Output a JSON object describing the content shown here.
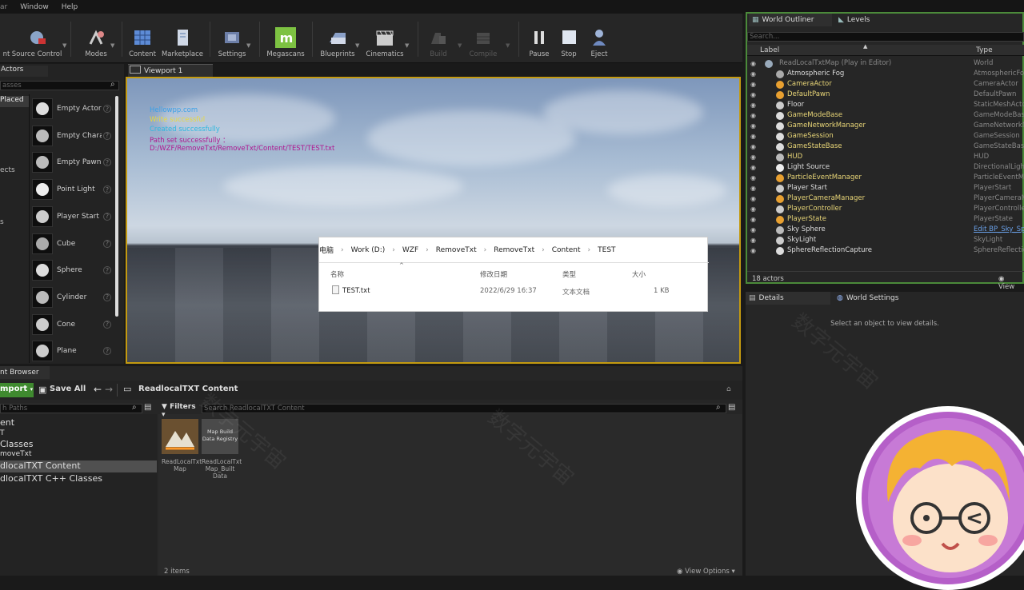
{
  "menu": [
    "Window",
    "Help"
  ],
  "toolbar": {
    "source_control": "Source Control",
    "modes": "Modes",
    "content": "Content",
    "marketplace": "Marketplace",
    "settings": "Settings",
    "megascans": "Megascans",
    "blueprints": "Blueprints",
    "cinematics": "Cinematics",
    "build": "Build",
    "compile": "Compile",
    "pause": "Pause",
    "stop": "Stop",
    "eject": "Eject"
  },
  "place": {
    "tab": "Actors",
    "search_placeholder": "asses",
    "recently_placed": "Placed",
    "categories": [
      "ects",
      "s"
    ],
    "items": [
      "Empty Actor",
      "Empty Chara",
      "Empty Pawn",
      "Point Light",
      "Player Start",
      "Cube",
      "Sphere",
      "Cylinder",
      "Cone",
      "Plane"
    ]
  },
  "viewport": {
    "tab": "Viewport 1",
    "debug": [
      "Hellowpp.com",
      "Write successful",
      "Created successfully",
      "Path set successfully ：",
      "D:/WZF/RemoveTxt/RemoveTxt/Content/TEST/TEST.txt"
    ]
  },
  "explorer": {
    "crumbs": [
      "电脑",
      "Work (D:)",
      "WZF",
      "RemoveTxt",
      "RemoveTxt",
      "Content",
      "TEST"
    ],
    "headers": {
      "name": "名称",
      "date": "修改日期",
      "type": "类型",
      "size": "大小"
    },
    "file": {
      "name": "TEST.txt",
      "date": "2022/6/29 16:37",
      "type": "文本文档",
      "size": "1 KB"
    }
  },
  "outliner": {
    "tab": "World Outliner",
    "tab2": "Levels",
    "search": "Search...",
    "col_label": "Label",
    "col_type": "Type",
    "rows": [
      {
        "name": "ReadLocalTxtMap (Play in Editor)",
        "type": "World",
        "style": "dim"
      },
      {
        "name": "Atmospheric Fog",
        "type": "AtmosphericFog",
        "style": ""
      },
      {
        "name": "CameraActor",
        "type": "CameraActor",
        "style": "ylw"
      },
      {
        "name": "DefaultPawn",
        "type": "DefaultPawn",
        "style": "ylw"
      },
      {
        "name": "Floor",
        "type": "StaticMeshActor",
        "style": ""
      },
      {
        "name": "GameModeBase",
        "type": "GameModeBase",
        "style": "ylw"
      },
      {
        "name": "GameNetworkManager",
        "type": "GameNetworkManager",
        "style": "ylw"
      },
      {
        "name": "GameSession",
        "type": "GameSession",
        "style": "ylw"
      },
      {
        "name": "GameStateBase",
        "type": "GameStateBase",
        "style": "ylw"
      },
      {
        "name": "HUD",
        "type": "HUD",
        "style": "ylw"
      },
      {
        "name": "Light Source",
        "type": "DirectionalLight",
        "style": ""
      },
      {
        "name": "ParticleEventManager",
        "type": "ParticleEventManager",
        "style": "ylw"
      },
      {
        "name": "Player Start",
        "type": "PlayerStart",
        "style": ""
      },
      {
        "name": "PlayerCameraManager",
        "type": "PlayerCameraManager",
        "style": "ylw"
      },
      {
        "name": "PlayerController",
        "type": "PlayerController",
        "style": "ylw"
      },
      {
        "name": "PlayerState",
        "type": "PlayerState",
        "style": "ylw"
      },
      {
        "name": "Sky Sphere",
        "type": "Edit BP_Sky_Sphere",
        "style": ""
      },
      {
        "name": "SkyLight",
        "type": "SkyLight",
        "style": ""
      },
      {
        "name": "SphereReflectionCapture",
        "type": "SphereReflectionCapture",
        "style": ""
      }
    ],
    "count": "18 actors",
    "view": "View"
  },
  "details": {
    "tab": "Details",
    "tab2": "World Settings",
    "empty": "Select an object to view details."
  },
  "content_browser": {
    "tab": "nt Browser",
    "import": "mport",
    "save_all": "Save All",
    "path": "ReadlocalTXT Content",
    "search_paths": "h Paths",
    "filters": "Filters",
    "search_assets": "Search ReadlocalTXT Content",
    "tree": [
      "ent",
      "T",
      "Classes",
      "moveTxt",
      "dlocalTXT Content",
      "dlocalTXT C++ Classes"
    ],
    "assets": [
      {
        "name": "ReadLocalTxt Map"
      },
      {
        "name": "ReadLocalTxt Map_Built Data",
        "thumb": "Map Build Data Registry"
      }
    ],
    "count": "2 items",
    "view_options": "View Options"
  },
  "colors": {
    "accent": "#c49a10",
    "selection": "#4b8a3a",
    "import": "#3f8a2f"
  }
}
